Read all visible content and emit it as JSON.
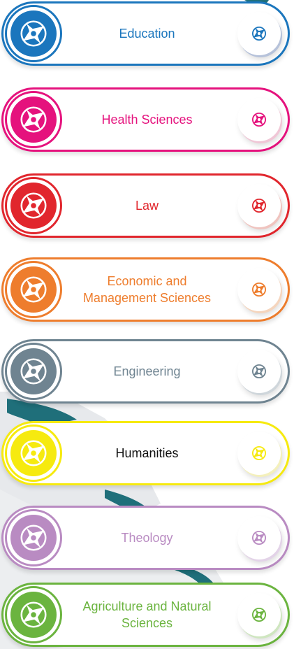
{
  "faculties": [
    {
      "label": "Education",
      "color": "#1b76bd",
      "text_color": "#1b76bd",
      "icon": "compass-icon"
    },
    {
      "label": "Health Sciences",
      "color": "#e5127d",
      "text_color": "#e5127d",
      "icon": "compass-icon"
    },
    {
      "label": "Law",
      "color": "#e1262d",
      "text_color": "#e1262d",
      "icon": "compass-icon"
    },
    {
      "label": "Economic and Management Sciences",
      "color": "#ee7d2d",
      "text_color": "#ee7d2d",
      "icon": "compass-icon"
    },
    {
      "label": "Engineering",
      "color": "#6f8491",
      "text_color": "#6f8491",
      "icon": "compass-icon"
    },
    {
      "label": "Humanities",
      "color": "#f6ea0f",
      "text_color": "#111111",
      "icon": "compass-icon"
    },
    {
      "label": "Theology",
      "color": "#b98bc2",
      "text_color": "#b98bc2",
      "icon": "compass-icon"
    },
    {
      "label": "Agriculture and Natural Sciences",
      "color": "#6bb43f",
      "text_color": "#6bb43f",
      "icon": "compass-icon"
    }
  ]
}
